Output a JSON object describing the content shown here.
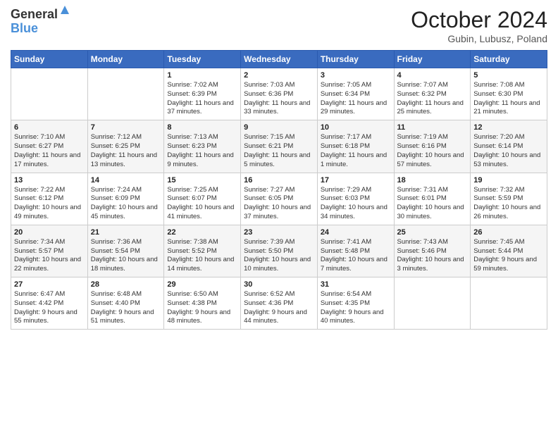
{
  "header": {
    "logo_line1": "General",
    "logo_line2": "Blue",
    "month": "October 2024",
    "location": "Gubin, Lubusz, Poland"
  },
  "weekdays": [
    "Sunday",
    "Monday",
    "Tuesday",
    "Wednesday",
    "Thursday",
    "Friday",
    "Saturday"
  ],
  "weeks": [
    [
      {
        "day": "",
        "info": ""
      },
      {
        "day": "",
        "info": ""
      },
      {
        "day": "1",
        "info": "Sunrise: 7:02 AM\nSunset: 6:39 PM\nDaylight: 11 hours and 37 minutes."
      },
      {
        "day": "2",
        "info": "Sunrise: 7:03 AM\nSunset: 6:36 PM\nDaylight: 11 hours and 33 minutes."
      },
      {
        "day": "3",
        "info": "Sunrise: 7:05 AM\nSunset: 6:34 PM\nDaylight: 11 hours and 29 minutes."
      },
      {
        "day": "4",
        "info": "Sunrise: 7:07 AM\nSunset: 6:32 PM\nDaylight: 11 hours and 25 minutes."
      },
      {
        "day": "5",
        "info": "Sunrise: 7:08 AM\nSunset: 6:30 PM\nDaylight: 11 hours and 21 minutes."
      }
    ],
    [
      {
        "day": "6",
        "info": "Sunrise: 7:10 AM\nSunset: 6:27 PM\nDaylight: 11 hours and 17 minutes."
      },
      {
        "day": "7",
        "info": "Sunrise: 7:12 AM\nSunset: 6:25 PM\nDaylight: 11 hours and 13 minutes."
      },
      {
        "day": "8",
        "info": "Sunrise: 7:13 AM\nSunset: 6:23 PM\nDaylight: 11 hours and 9 minutes."
      },
      {
        "day": "9",
        "info": "Sunrise: 7:15 AM\nSunset: 6:21 PM\nDaylight: 11 hours and 5 minutes."
      },
      {
        "day": "10",
        "info": "Sunrise: 7:17 AM\nSunset: 6:18 PM\nDaylight: 11 hours and 1 minute."
      },
      {
        "day": "11",
        "info": "Sunrise: 7:19 AM\nSunset: 6:16 PM\nDaylight: 10 hours and 57 minutes."
      },
      {
        "day": "12",
        "info": "Sunrise: 7:20 AM\nSunset: 6:14 PM\nDaylight: 10 hours and 53 minutes."
      }
    ],
    [
      {
        "day": "13",
        "info": "Sunrise: 7:22 AM\nSunset: 6:12 PM\nDaylight: 10 hours and 49 minutes."
      },
      {
        "day": "14",
        "info": "Sunrise: 7:24 AM\nSunset: 6:09 PM\nDaylight: 10 hours and 45 minutes."
      },
      {
        "day": "15",
        "info": "Sunrise: 7:25 AM\nSunset: 6:07 PM\nDaylight: 10 hours and 41 minutes."
      },
      {
        "day": "16",
        "info": "Sunrise: 7:27 AM\nSunset: 6:05 PM\nDaylight: 10 hours and 37 minutes."
      },
      {
        "day": "17",
        "info": "Sunrise: 7:29 AM\nSunset: 6:03 PM\nDaylight: 10 hours and 34 minutes."
      },
      {
        "day": "18",
        "info": "Sunrise: 7:31 AM\nSunset: 6:01 PM\nDaylight: 10 hours and 30 minutes."
      },
      {
        "day": "19",
        "info": "Sunrise: 7:32 AM\nSunset: 5:59 PM\nDaylight: 10 hours and 26 minutes."
      }
    ],
    [
      {
        "day": "20",
        "info": "Sunrise: 7:34 AM\nSunset: 5:57 PM\nDaylight: 10 hours and 22 minutes."
      },
      {
        "day": "21",
        "info": "Sunrise: 7:36 AM\nSunset: 5:54 PM\nDaylight: 10 hours and 18 minutes."
      },
      {
        "day": "22",
        "info": "Sunrise: 7:38 AM\nSunset: 5:52 PM\nDaylight: 10 hours and 14 minutes."
      },
      {
        "day": "23",
        "info": "Sunrise: 7:39 AM\nSunset: 5:50 PM\nDaylight: 10 hours and 10 minutes."
      },
      {
        "day": "24",
        "info": "Sunrise: 7:41 AM\nSunset: 5:48 PM\nDaylight: 10 hours and 7 minutes."
      },
      {
        "day": "25",
        "info": "Sunrise: 7:43 AM\nSunset: 5:46 PM\nDaylight: 10 hours and 3 minutes."
      },
      {
        "day": "26",
        "info": "Sunrise: 7:45 AM\nSunset: 5:44 PM\nDaylight: 9 hours and 59 minutes."
      }
    ],
    [
      {
        "day": "27",
        "info": "Sunrise: 6:47 AM\nSunset: 4:42 PM\nDaylight: 9 hours and 55 minutes."
      },
      {
        "day": "28",
        "info": "Sunrise: 6:48 AM\nSunset: 4:40 PM\nDaylight: 9 hours and 51 minutes."
      },
      {
        "day": "29",
        "info": "Sunrise: 6:50 AM\nSunset: 4:38 PM\nDaylight: 9 hours and 48 minutes."
      },
      {
        "day": "30",
        "info": "Sunrise: 6:52 AM\nSunset: 4:36 PM\nDaylight: 9 hours and 44 minutes."
      },
      {
        "day": "31",
        "info": "Sunrise: 6:54 AM\nSunset: 4:35 PM\nDaylight: 9 hours and 40 minutes."
      },
      {
        "day": "",
        "info": ""
      },
      {
        "day": "",
        "info": ""
      }
    ]
  ]
}
